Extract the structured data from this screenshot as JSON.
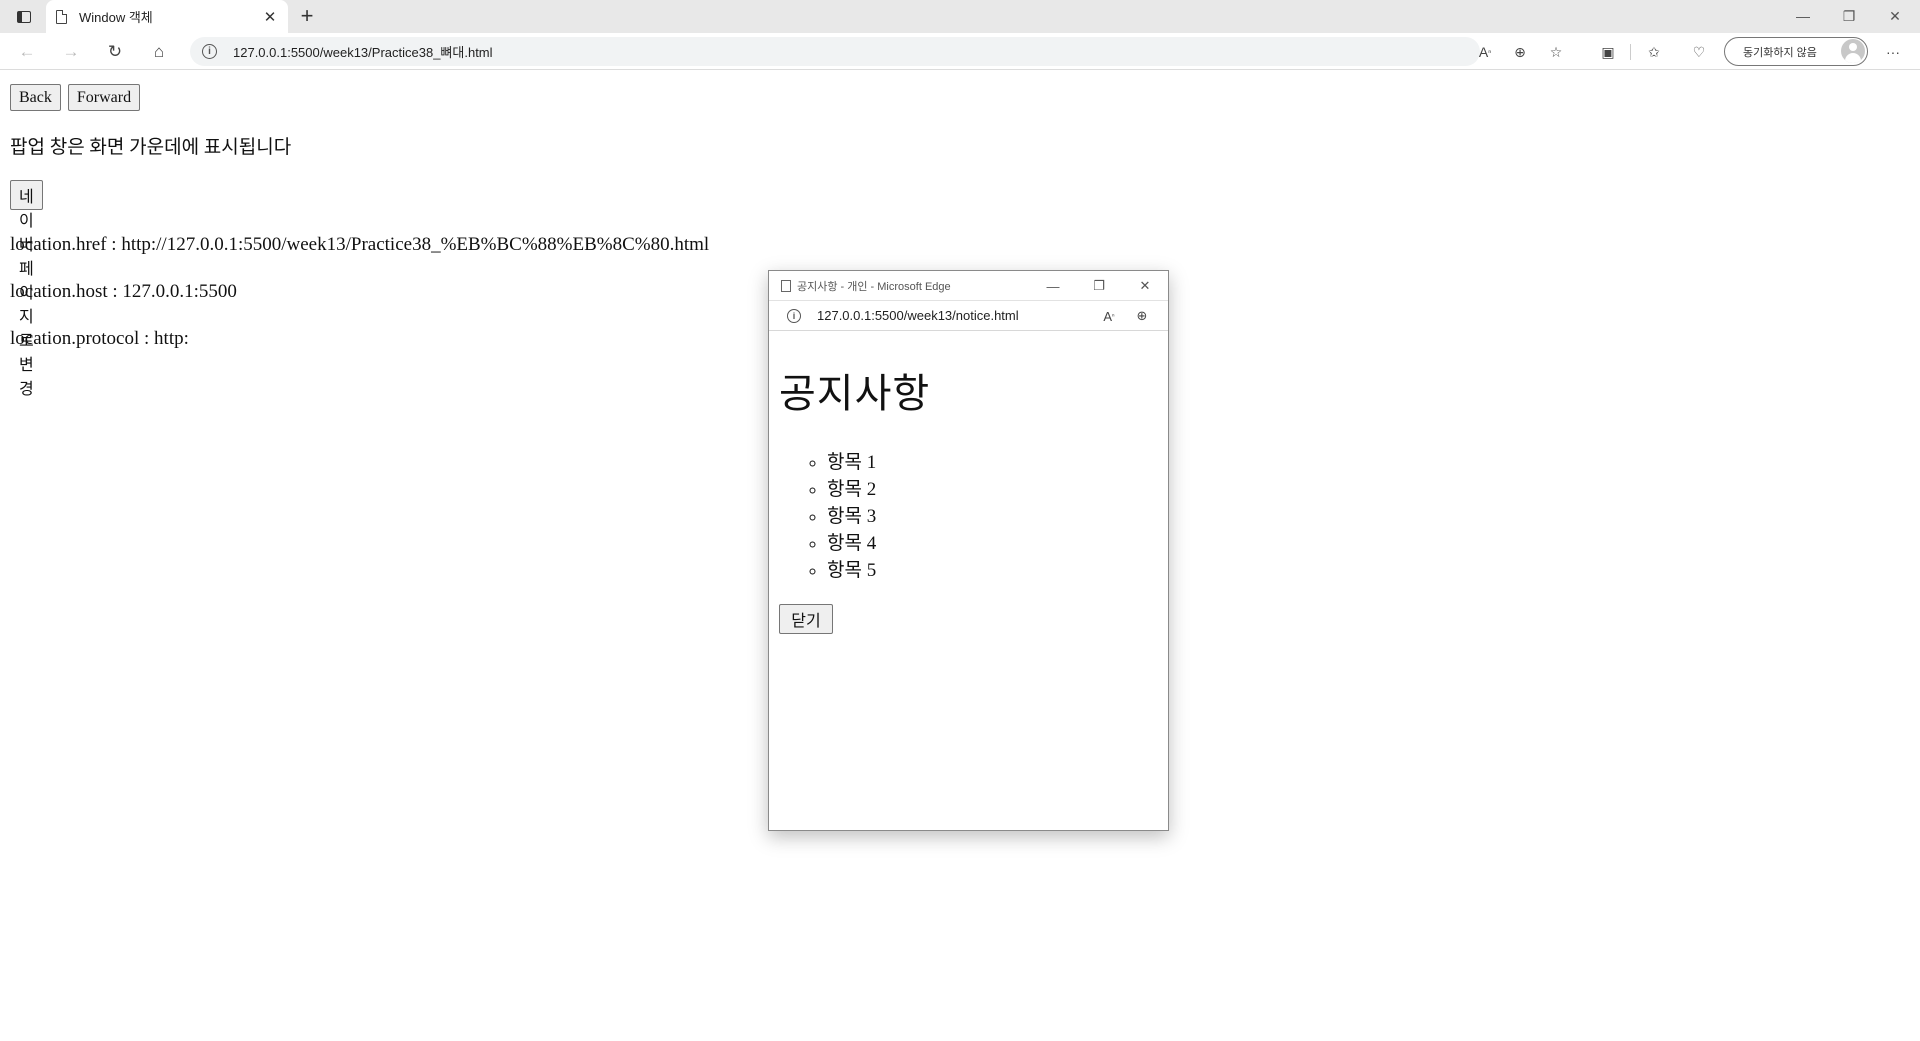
{
  "browser": {
    "tab_title": "Window 객체",
    "tab_close": "✕",
    "new_tab": "+",
    "url": "127.0.0.1:5500/week13/Practice38_뼈대.html",
    "profile_label": "동기화하지 않음",
    "window_controls": {
      "minimize": "—",
      "restore": "❐",
      "close": "✕"
    }
  },
  "page": {
    "back_label": "Back",
    "forward_label": "Forward",
    "notice_text": "팝업 창은 화면 가운데에 표시됩니다",
    "naver_button_label": "네이버 페이지로 변경",
    "location_href": "location.href : http://127.0.0.1:5500/week13/Practice38_%EB%BC%88%EB%8C%80.html",
    "location_host": "location.host : 127.0.0.1:5500",
    "location_protocol": "location.protocol : http:"
  },
  "popup": {
    "window_title": "공지사항 - 개인 - Microsoft Edge",
    "url": "127.0.0.1:5500/week13/notice.html",
    "heading": "공지사항",
    "items": [
      "항목 1",
      "항목 2",
      "항목 3",
      "항목 4",
      "항목 5"
    ],
    "close_label": "닫기"
  }
}
